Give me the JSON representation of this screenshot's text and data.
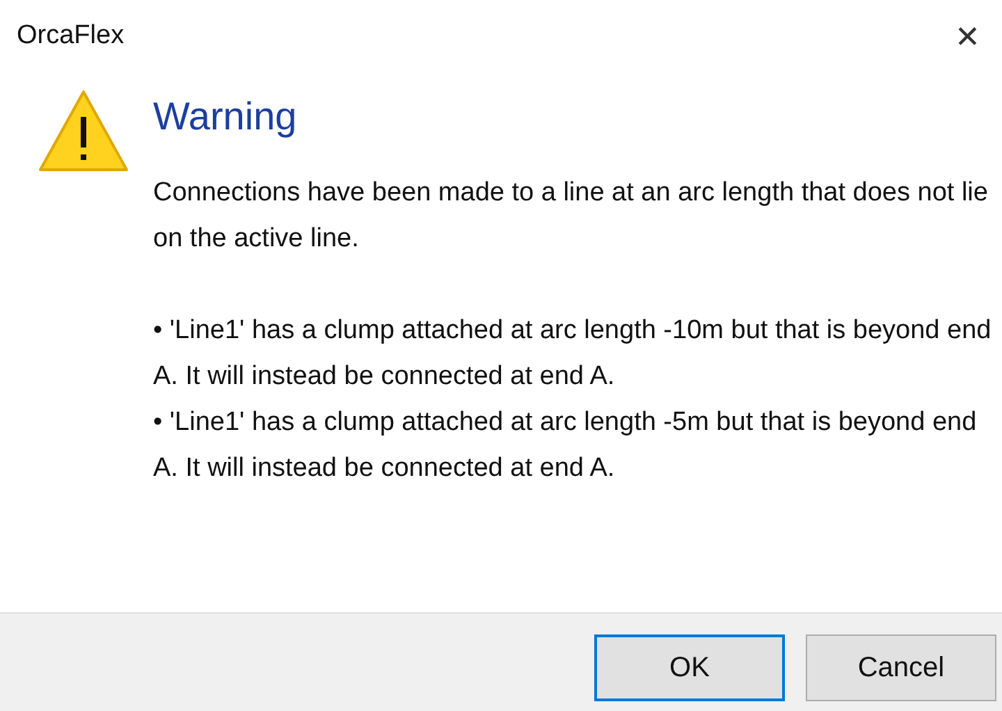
{
  "window": {
    "title": "OrcaFlex",
    "close": "✕"
  },
  "heading": "Warning",
  "message": "Connections have been made to a line at an arc length that does not lie on the active line.",
  "bullets": [
    "• 'Line1' has a clump attached at arc length -10m but that is beyond end A. It will instead be connected at end A.",
    "• 'Line1' has a clump attached at arc length -5m but that is beyond end A. It will instead be connected at end A."
  ],
  "buttons": [
    {
      "label": "OK",
      "selected": true
    },
    {
      "label": "Cancel",
      "selected": false
    }
  ]
}
